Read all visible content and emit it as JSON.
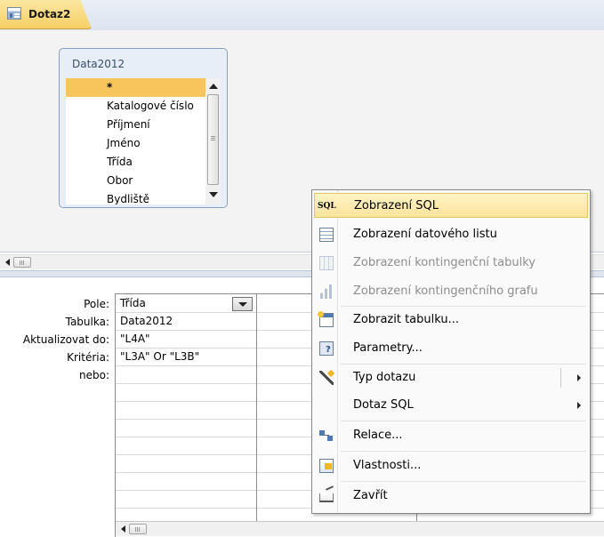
{
  "tab": {
    "label": "Dotaz2"
  },
  "table_box": {
    "title": "Data2012",
    "fields": [
      "*",
      "Katalogové číslo",
      "Příjmení",
      "Jméno",
      "Třída",
      "Obor",
      "Bydliště"
    ]
  },
  "grid": {
    "row_labels": [
      "Pole:",
      "Tabulka:",
      "Aktualizovat do:",
      "Kritéria:",
      "nebo:"
    ],
    "column1": [
      "Třída",
      "Data2012",
      "\"L4A\"",
      "\"L3A\" Or \"L3B\"",
      ""
    ]
  },
  "menu": {
    "items": [
      {
        "icon": "sql-icon",
        "text": "SQL",
        "label": "Zobrazení SQL",
        "state": "highlighted"
      },
      {
        "icon": "datasheet-icon",
        "label": "Zobrazení datového listu",
        "state": "enabled"
      },
      {
        "icon": "pivot-table-icon",
        "label": "Zobrazení kontingenční tabulky",
        "state": "disabled"
      },
      {
        "icon": "pivot-chart-icon",
        "label": "Zobrazení kontingenčního grafu",
        "state": "disabled"
      },
      {
        "icon": "show-table-icon",
        "label": "Zobrazit tabulku...",
        "state": "enabled"
      },
      {
        "icon": "parameters-icon",
        "label": "Parametry...",
        "state": "enabled"
      },
      {
        "icon": "query-type-icon",
        "label": "Typ dotazu",
        "state": "submenu"
      },
      {
        "icon": "",
        "label": "Dotaz SQL",
        "state": "submenu"
      },
      {
        "icon": "relationships-icon",
        "label": "Relace...",
        "state": "enabled"
      },
      {
        "icon": "properties-icon",
        "label": "Vlastnosti...",
        "state": "enabled"
      },
      {
        "icon": "close-icon",
        "label": "Zavřít",
        "state": "enabled"
      }
    ]
  },
  "colors": {
    "highlight": "#fde49b",
    "selected_field": "#f7c55b",
    "tab": "#f6cf65"
  }
}
